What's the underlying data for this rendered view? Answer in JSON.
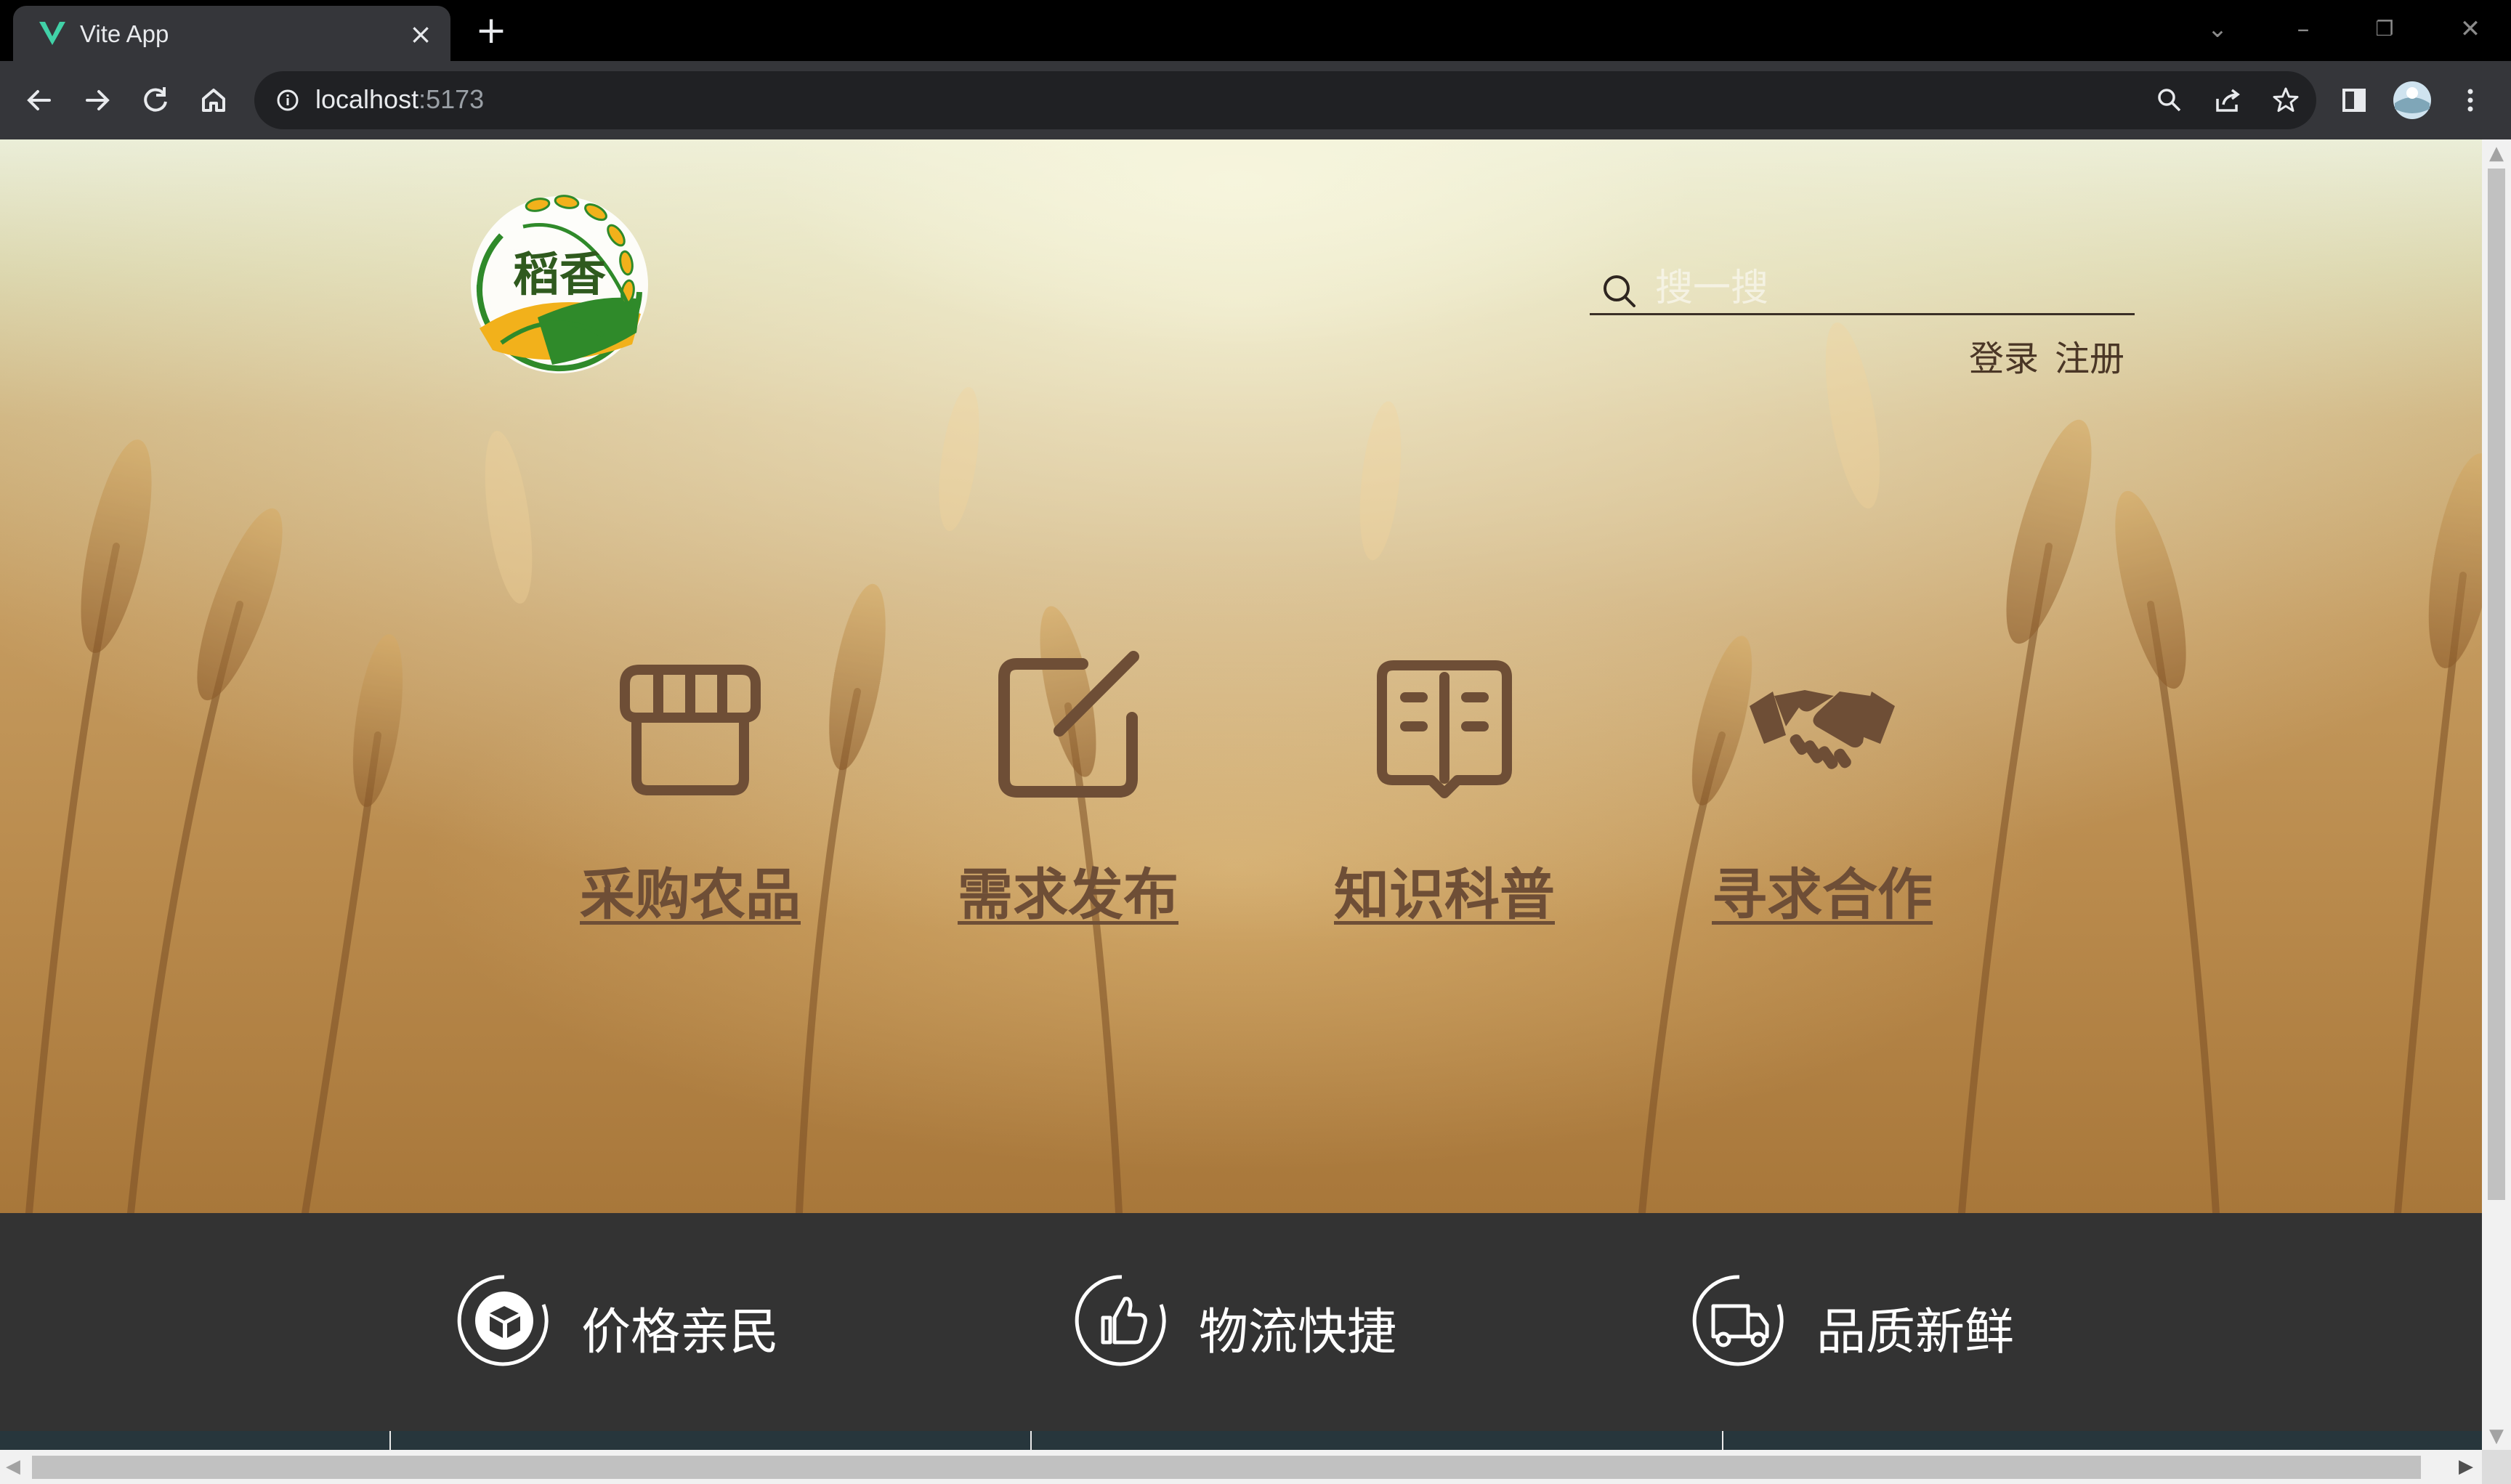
{
  "browser": {
    "tab_title": "Vite App",
    "url_host": "localhost",
    "url_port": ":5173"
  },
  "page": {
    "search_placeholder": "搜一搜",
    "auth": {
      "login": "登录",
      "register": "注册"
    },
    "logo_text": "稻香",
    "features": [
      {
        "label": "采购农品",
        "icon": "storefront-icon"
      },
      {
        "label": "需求发布",
        "icon": "edit-icon"
      },
      {
        "label": "知识科普",
        "icon": "book-icon"
      },
      {
        "label": "寻求合作",
        "icon": "handshake-icon"
      }
    ],
    "highlights": [
      {
        "label": "价格亲民",
        "icon": "box-icon"
      },
      {
        "label": "物流快捷",
        "icon": "thumbs-up-icon"
      },
      {
        "label": "品质新鲜",
        "icon": "delivery-truck-icon"
      }
    ],
    "colors": {
      "feature_brown": "#6e4e36",
      "strip_background": "#333333",
      "logo_green": "#2f8a2a",
      "logo_yellow": "#f2b11b"
    }
  }
}
